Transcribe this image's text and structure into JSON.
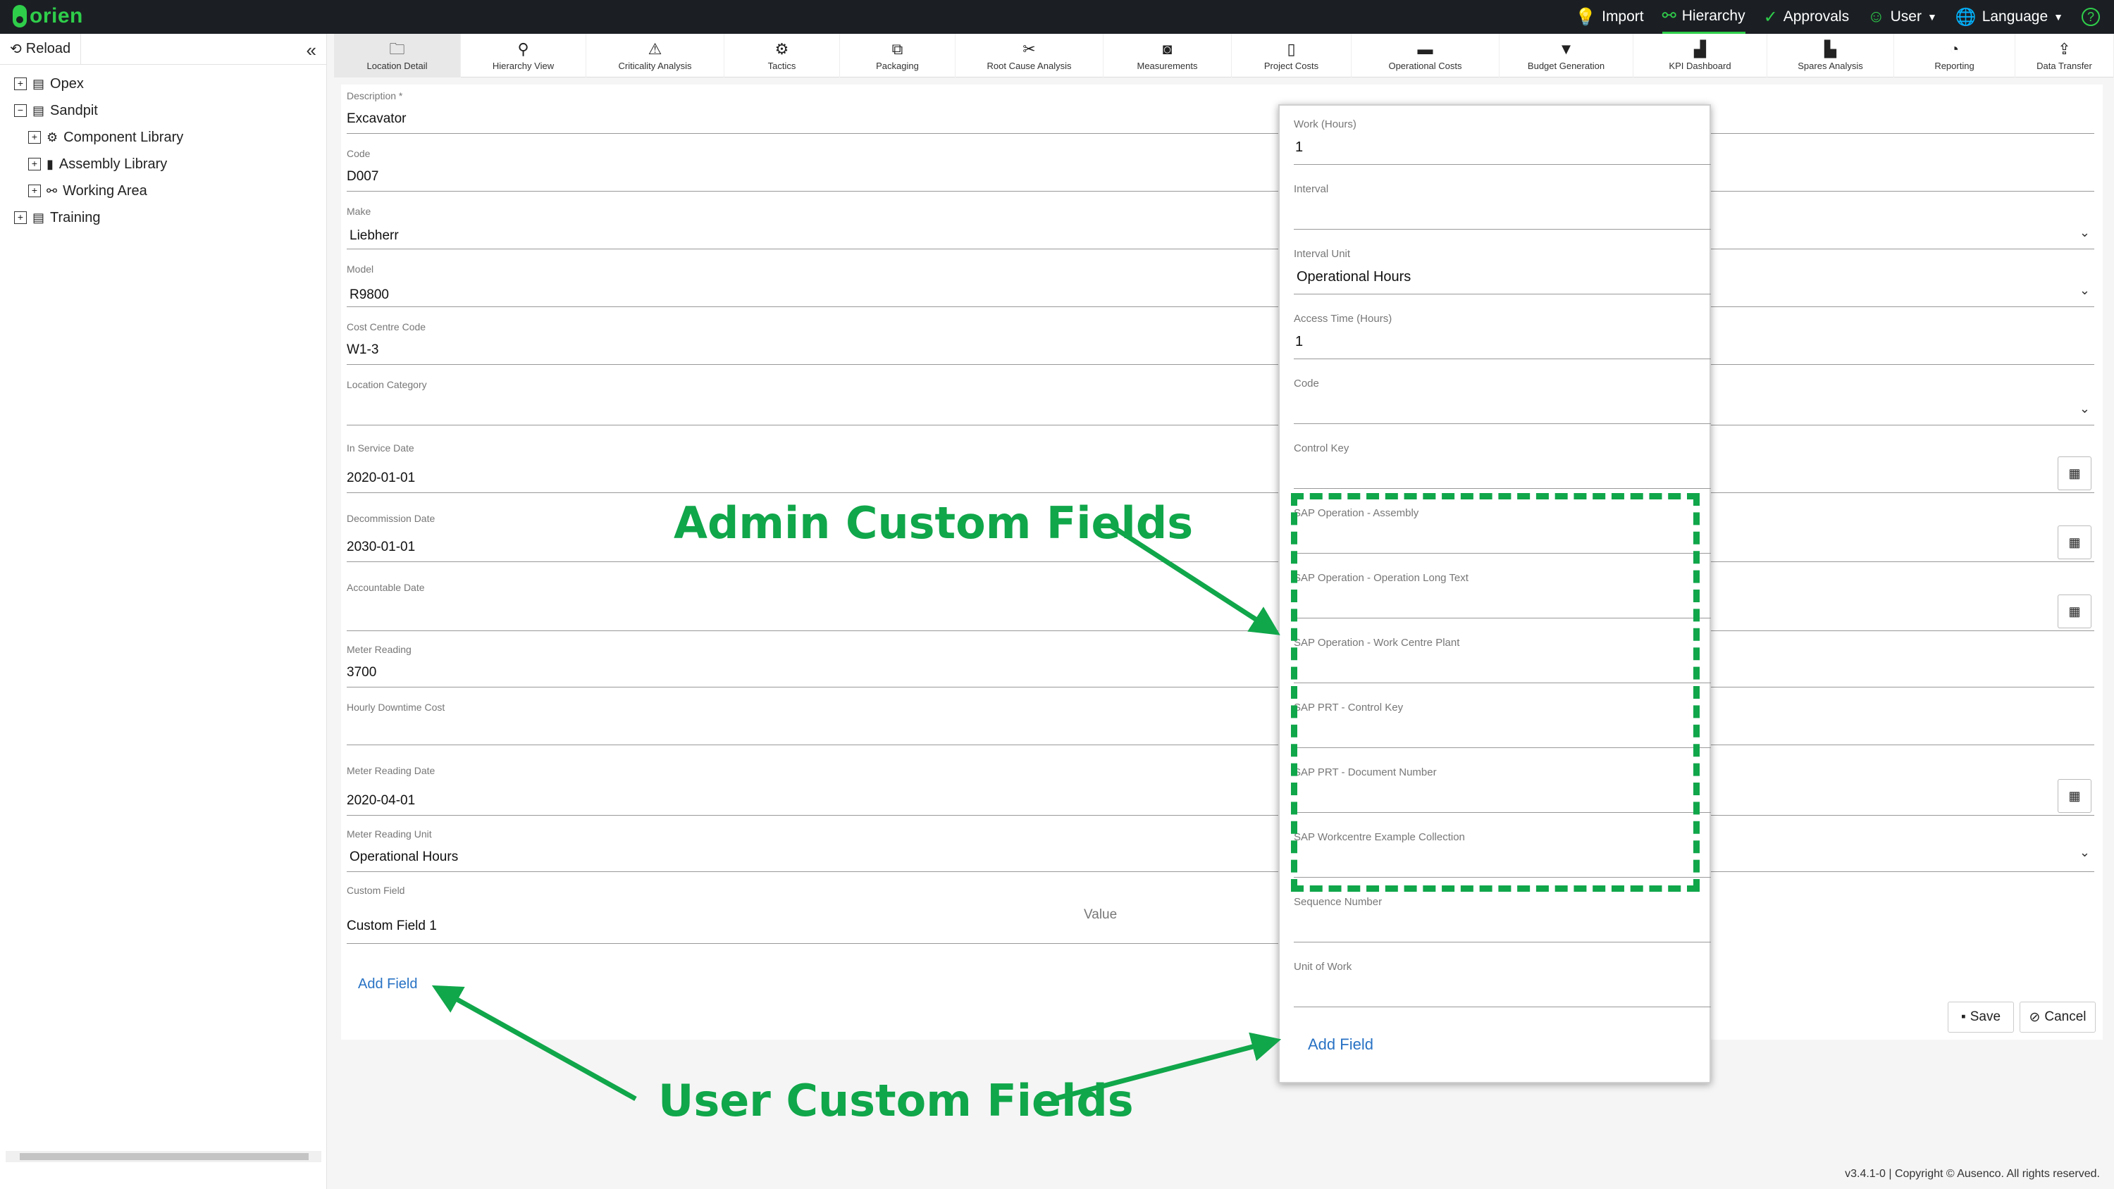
{
  "app": {
    "logo_text": "orien",
    "accent": "#2fce4a"
  },
  "topnav": [
    {
      "label": "Import",
      "icon": "lightbulb-icon",
      "glyph": "💡"
    },
    {
      "label": "Hierarchy",
      "icon": "hierarchy-icon",
      "glyph": "⚯"
    },
    {
      "label": "Approvals",
      "icon": "check-circle-icon",
      "glyph": "✓"
    },
    {
      "label": "User",
      "icon": "user-icon",
      "glyph": "☺"
    },
    {
      "label": "Language",
      "icon": "globe-icon",
      "glyph": "🌐"
    },
    {
      "label": "",
      "icon": "help-icon",
      "glyph": "?"
    }
  ],
  "sidebar": {
    "reload_label": "Reload",
    "tree": [
      {
        "label": "Opex",
        "toggle": "+",
        "indent": 0
      },
      {
        "label": "Sandpit",
        "toggle": "−",
        "indent": 0
      },
      {
        "label": "Component Library",
        "toggle": "+",
        "indent": 1
      },
      {
        "label": "Assembly Library",
        "toggle": "+",
        "indent": 1
      },
      {
        "label": "Working Area",
        "toggle": "+",
        "indent": 1
      },
      {
        "label": "Training",
        "toggle": "+",
        "indent": 0
      }
    ]
  },
  "tabs": [
    {
      "label": "Location Detail",
      "icon": "folder-icon"
    },
    {
      "label": "Hierarchy View",
      "icon": "search-icon"
    },
    {
      "label": "Criticality Analysis",
      "icon": "warning-icon"
    },
    {
      "label": "Tactics",
      "icon": "gear-icon"
    },
    {
      "label": "Packaging",
      "icon": "package-icon"
    },
    {
      "label": "Root Cause Analysis",
      "icon": "tools-icon"
    },
    {
      "label": "Measurements",
      "icon": "gauge-icon"
    },
    {
      "label": "Project Costs",
      "icon": "document-dollar-icon"
    },
    {
      "label": "Operational Costs",
      "icon": "credit-card-icon"
    },
    {
      "label": "Budget Generation",
      "icon": "filter-dollar-icon"
    },
    {
      "label": "KPI Dashboard",
      "icon": "bar-chart-icon"
    },
    {
      "label": "Spares Analysis",
      "icon": "pallet-icon"
    },
    {
      "label": "Reporting",
      "icon": "pie-chart-icon"
    },
    {
      "label": "Data Transfer",
      "icon": "share-icon"
    }
  ],
  "form": {
    "description": {
      "label": "Description *",
      "value": "Excavator"
    },
    "code": {
      "label": "Code",
      "value": "D007"
    },
    "make": {
      "label": "Make",
      "value": "Liebherr"
    },
    "model": {
      "label": "Model",
      "value": "R9800"
    },
    "cost_centre": {
      "label": "Cost Centre Code",
      "value": "W1-3"
    },
    "location_category": {
      "label": "Location Category",
      "value": ""
    },
    "in_service_date": {
      "label": "In Service Date",
      "value": "2020-01-01"
    },
    "decommission_date": {
      "label": "Decommission Date",
      "value": "2030-01-01"
    },
    "accountable_date": {
      "label": "Accountable Date",
      "value": ""
    },
    "meter_reading": {
      "label": "Meter Reading",
      "value": "3700"
    },
    "hourly_downtime_cost": {
      "label": "Hourly Downtime Cost",
      "value": ""
    },
    "meter_reading_date": {
      "label": "Meter Reading Date",
      "value": "2020-04-01"
    },
    "meter_reading_unit": {
      "label": "Meter Reading Unit",
      "value": "Operational Hours"
    },
    "custom_field": {
      "label": "Custom Field",
      "value": "Custom Field 1",
      "value_placeholder": "Value"
    },
    "add_field_label": "Add Field",
    "save_label": "Save",
    "cancel_label": "Cancel"
  },
  "popup": {
    "fields": [
      {
        "label": "Work (Hours)",
        "value": "1"
      },
      {
        "label": "Interval",
        "value": ""
      },
      {
        "label": "Interval Unit",
        "value": "Operational Hours"
      },
      {
        "label": "Access Time (Hours)",
        "value": "1"
      },
      {
        "label": "Code",
        "value": ""
      },
      {
        "label": "Control Key",
        "value": ""
      },
      {
        "label": "SAP Operation - Assembly",
        "value": ""
      },
      {
        "label": "SAP Operation - Operation Long Text",
        "value": ""
      },
      {
        "label": "SAP Operation - Work Centre Plant",
        "value": ""
      },
      {
        "label": "SAP PRT - Control Key",
        "value": ""
      },
      {
        "label": "SAP PRT - Document Number",
        "value": ""
      },
      {
        "label": "SAP Workcentre Example Collection",
        "value": ""
      },
      {
        "label": "Sequence Number",
        "value": ""
      },
      {
        "label": "Unit of Work",
        "value": ""
      }
    ],
    "add_field_label": "Add Field"
  },
  "annotations": {
    "admin": "Admin Custom Fields",
    "user": "User Custom Fields",
    "color": "#10a64a"
  },
  "footer": "v3.4.1-0 | Copyright © Ausenco. All rights reserved."
}
